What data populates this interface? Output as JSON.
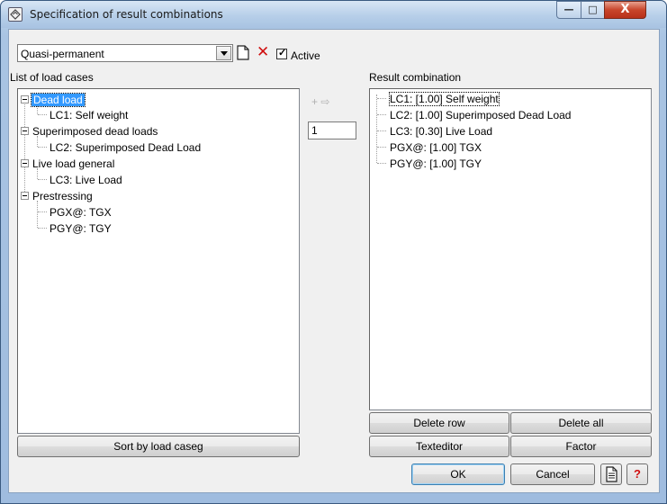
{
  "window": {
    "title": "Specification of result combinations",
    "minimize_glyph": "—",
    "maximize_glyph": "□",
    "close_glyph": "X"
  },
  "toolbar": {
    "combination_value": "Quasi-permanent",
    "new_icon": "new-document-icon",
    "delete_icon": "delete-x-icon",
    "delete_glyph": "✕",
    "active_checked": true,
    "active_check_glyph": "✓",
    "active_label": "Active"
  },
  "load_cases": {
    "label": "List of load cases",
    "groups": [
      {
        "name": "Dead load",
        "selected": true,
        "items": [
          "LC1: Self weight"
        ]
      },
      {
        "name": "Superimposed dead loads",
        "selected": false,
        "items": [
          "LC2: Superimposed Dead Load"
        ]
      },
      {
        "name": "Live load general",
        "selected": false,
        "items": [
          "LC3: Live Load"
        ]
      },
      {
        "name": "Prestressing",
        "selected": false,
        "items": [
          "PGX@: TGX",
          "PGY@: TGY"
        ]
      }
    ],
    "sort_button": "Sort by load caseg"
  },
  "transfer": {
    "arrow_label": "+ ⇨",
    "factor_value": "1"
  },
  "result": {
    "label": "Result combination",
    "rows": [
      "LC1:  [1.00]  Self weight",
      "LC2:  [1.00]  Superimposed Dead Load",
      "LC3:  [0.30]  Live Load",
      "PGX@:  [1.00]  TGX",
      "PGY@:  [1.00]  TGY"
    ],
    "delete_row": "Delete row",
    "delete_all": "Delete all",
    "texteditor": "Texteditor",
    "factor": "Factor"
  },
  "footer": {
    "ok": "OK",
    "cancel": "Cancel",
    "doc_icon": "document-icon",
    "help_icon": "help-icon",
    "help_glyph": "?"
  },
  "colors": {
    "selection": "#3399ff",
    "help_accent": "#d01010"
  }
}
